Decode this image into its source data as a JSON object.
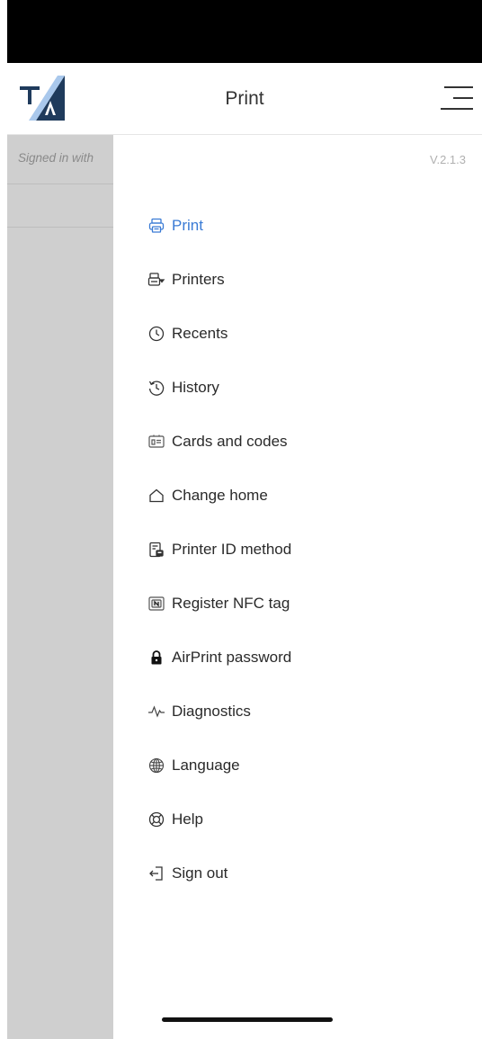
{
  "header": {
    "title": "Print",
    "logo_letters": "TA"
  },
  "left_panel": {
    "signed_in_text": "Signed in with"
  },
  "drawer": {
    "version": "V.2.1.3",
    "items": [
      {
        "label": "Print",
        "icon": "printer-icon",
        "active": true
      },
      {
        "label": "Printers",
        "icon": "printers-icon",
        "active": false
      },
      {
        "label": "Recents",
        "icon": "clock-icon",
        "active": false
      },
      {
        "label": "History",
        "icon": "history-icon",
        "active": false
      },
      {
        "label": "Cards and codes",
        "icon": "id-card-icon",
        "active": false
      },
      {
        "label": "Change home",
        "icon": "home-icon",
        "active": false
      },
      {
        "label": "Printer ID method",
        "icon": "printer-id-icon",
        "active": false
      },
      {
        "label": "Register NFC tag",
        "icon": "nfc-icon",
        "active": false
      },
      {
        "label": "AirPrint password",
        "icon": "lock-icon",
        "active": false
      },
      {
        "label": "Diagnostics",
        "icon": "pulse-icon",
        "active": false
      },
      {
        "label": "Language",
        "icon": "globe-icon",
        "active": false
      },
      {
        "label": "Help",
        "icon": "lifebuoy-icon",
        "active": false
      },
      {
        "label": "Sign out",
        "icon": "sign-out-icon",
        "active": false
      }
    ]
  },
  "colors": {
    "accent": "#3a7bd5",
    "logo_dark": "#1f3b5c",
    "logo_light": "#a9c8ec"
  }
}
